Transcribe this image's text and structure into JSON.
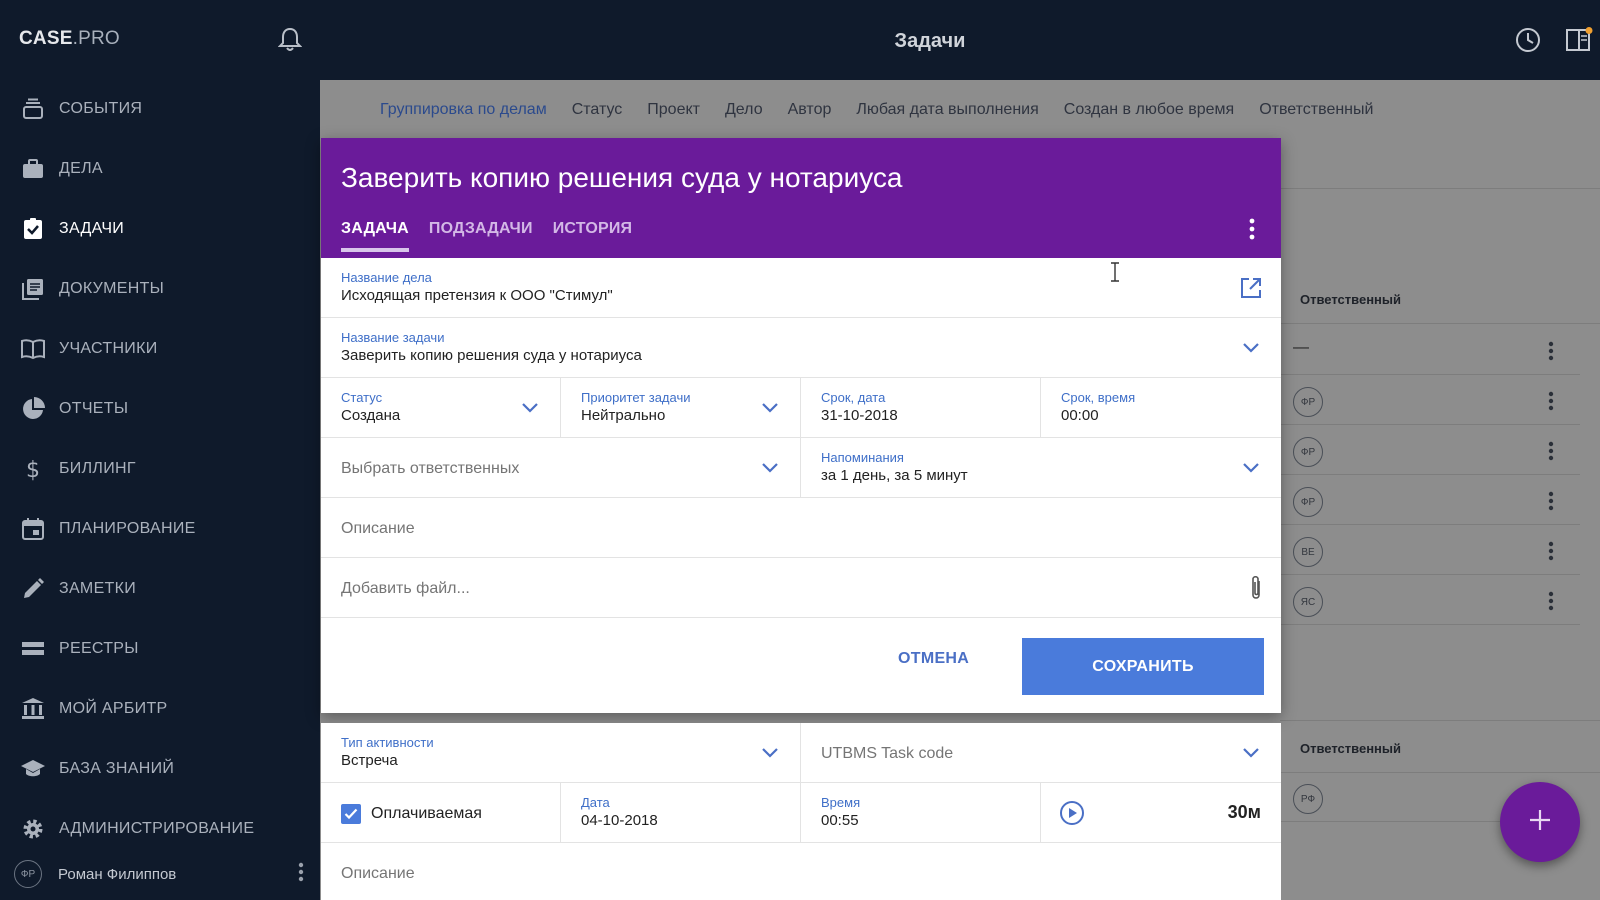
{
  "brand": {
    "case": "CASE",
    "pro": ".PRO"
  },
  "page_title": "Задачи",
  "sidebar": {
    "items": [
      {
        "label": "СОБЫТИЯ",
        "icon": "events-icon"
      },
      {
        "label": "ДЕЛА",
        "icon": "briefcase-icon"
      },
      {
        "label": "ЗАДАЧИ",
        "icon": "task-check-icon",
        "active": true
      },
      {
        "label": "ДОКУМЕНТЫ",
        "icon": "documents-icon"
      },
      {
        "label": "УЧАСТНИКИ",
        "icon": "book-icon"
      },
      {
        "label": "ОТЧЕТЫ",
        "icon": "pie-chart-icon"
      },
      {
        "label": "БИЛЛИНГ",
        "icon": "dollar-icon"
      },
      {
        "label": "ПЛАНИРОВАНИЕ",
        "icon": "calendar-icon"
      },
      {
        "label": "ЗАМЕТКИ",
        "icon": "pencil-icon"
      },
      {
        "label": "РЕЕСТРЫ",
        "icon": "registry-icon"
      },
      {
        "label": "МОЙ АРБИТР",
        "icon": "court-icon"
      },
      {
        "label": "БАЗА ЗНАНИЙ",
        "icon": "graduation-icon"
      },
      {
        "label": "АДМИНИСТРИРОВАНИЕ",
        "icon": "gear-icon"
      }
    ],
    "user": {
      "initials": "ФР",
      "name": "Роман Филиппов"
    }
  },
  "filters": [
    "Группировка по делам",
    "Статус",
    "Проект",
    "Дело",
    "Автор",
    "Любая дата выполнения",
    "Создан в любое время",
    "Ответственный"
  ],
  "background_table": {
    "header": "Ответственный",
    "rows": [
      "—",
      "ФР",
      "ФР",
      "ФР",
      "ВЕ",
      "ЯС"
    ],
    "header2": "Ответственный",
    "rows2": [
      "РФ"
    ]
  },
  "modal": {
    "title": "Заверить копию решения суда у нотариуса",
    "tabs": [
      "ЗАДАЧА",
      "ПОДЗАДАЧИ",
      "ИСТОРИЯ"
    ],
    "case_name_label": "Название дела",
    "case_name_value": "Исходящая претензия к ООО \"Стимул\"",
    "task_name_label": "Название задачи",
    "task_name_value": "Заверить копию решения суда у нотариуса",
    "status_label": "Статус",
    "status_value": "Создана",
    "priority_label": "Приоритет задачи",
    "priority_value": "Нейтрально",
    "due_date_label": "Срок, дата",
    "due_date_value": "31-10-2018",
    "due_time_label": "Срок, время",
    "due_time_value": "00:00",
    "assignees_placeholder": "Выбрать ответственных",
    "reminders_label": "Напоминания",
    "reminders_value": "за 1 день, за 5 минут",
    "description_placeholder": "Описание",
    "add_file_placeholder": "Добавить файл...",
    "cancel_label": "ОТМЕНА",
    "save_label": "СОХРАНИТЬ"
  },
  "panel2": {
    "activity_label": "Тип активности",
    "activity_value": "Встреча",
    "utbms_placeholder": "UTBMS Task code",
    "billable_label": "Оплачиваемая",
    "billable_checked": true,
    "date_label": "Дата",
    "date_value": "04-10-2018",
    "time_label": "Время",
    "time_value": "00:55",
    "duration_value": "30м",
    "description_placeholder": "Описание"
  },
  "colors": {
    "accent": "#6a1b9a",
    "primary": "#4a7bdb",
    "sidebar_bg": "#0f1a2b"
  }
}
